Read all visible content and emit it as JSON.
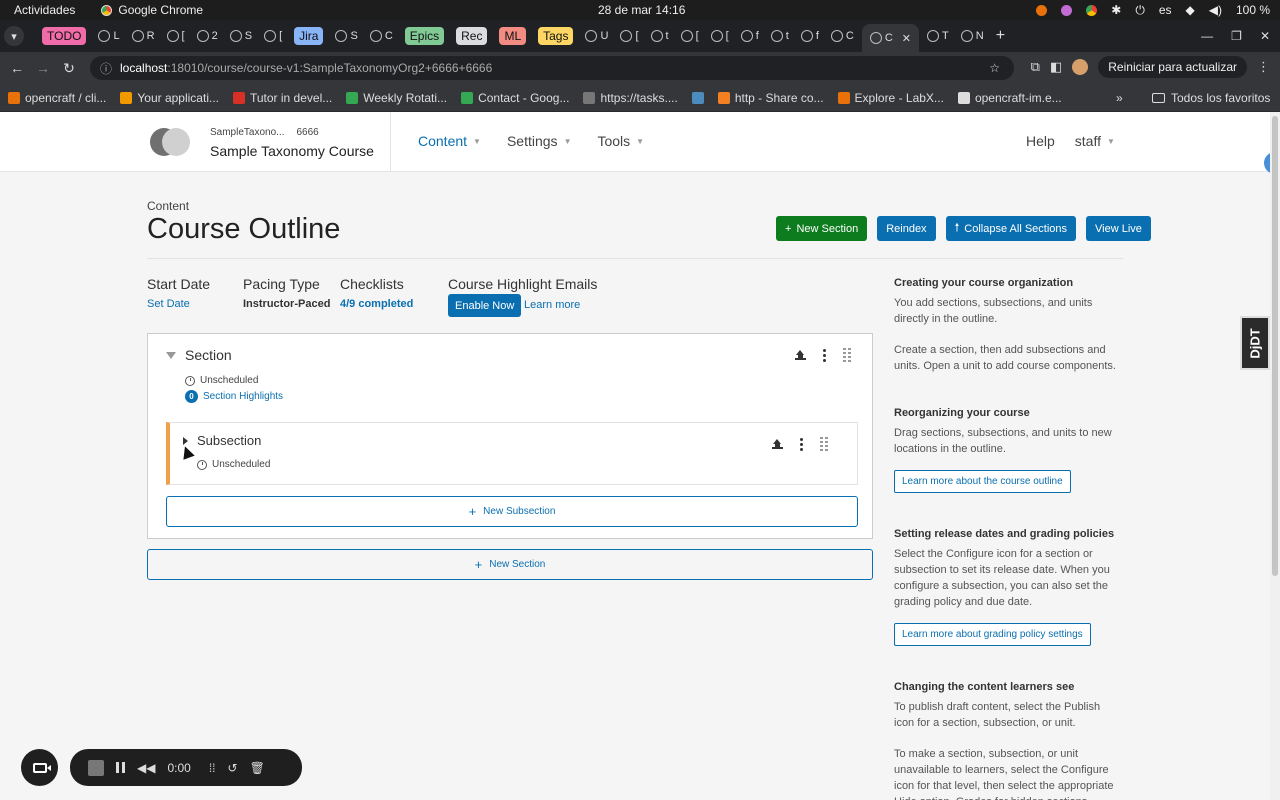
{
  "os": {
    "activities": "Actividades",
    "app_name": "Google Chrome",
    "clock": "28 de mar  14:16",
    "lang": "es",
    "battery": "100 %"
  },
  "tabs": [
    {
      "label": "TODO",
      "color": "#f06ca8",
      "pill": true
    },
    {
      "label": "L",
      "pill": false
    },
    {
      "label": "R",
      "pill": false
    },
    {
      "label": "[",
      "pill": false
    },
    {
      "label": "2",
      "pill": false
    },
    {
      "label": "S",
      "pill": false
    },
    {
      "label": "[",
      "pill": false
    },
    {
      "label": "Jira",
      "color": "#8ab4f8",
      "pill": true
    },
    {
      "label": "S",
      "pill": false
    },
    {
      "label": "C",
      "pill": false
    },
    {
      "label": "Epics",
      "color": "#81c995",
      "pill": true
    },
    {
      "label": "Rec",
      "color": "#dadce0",
      "pill": true
    },
    {
      "label": "ML",
      "color": "#f28b82",
      "pill": true
    },
    {
      "label": "Tags",
      "color": "#fdd663",
      "pill": true
    },
    {
      "label": "U",
      "pill": false
    },
    {
      "label": "[",
      "pill": false
    },
    {
      "label": "t",
      "pill": false
    },
    {
      "label": "[",
      "pill": false
    },
    {
      "label": "[",
      "pill": false
    },
    {
      "label": "f",
      "pill": false
    },
    {
      "label": "t",
      "pill": false
    },
    {
      "label": "f",
      "pill": false
    },
    {
      "label": "C",
      "pill": false
    },
    {
      "label": "C",
      "active": true
    },
    {
      "label": "T",
      "pill": false
    },
    {
      "label": "N",
      "pill": false
    }
  ],
  "address": {
    "host": "localhost",
    "path": ":18010/course/course-v1:SampleTaxonomyOrg2+6666+6666",
    "update_label": "Reiniciar para actualizar"
  },
  "bookmarks": [
    {
      "label": "opencraft / cli...",
      "color": "#e8710a"
    },
    {
      "label": "Your applicati...",
      "color": "#f29900"
    },
    {
      "label": "Tutor in devel...",
      "color": "#d93025"
    },
    {
      "label": "Weekly Rotati...",
      "color": "#34a853"
    },
    {
      "label": "Contact - Goog...",
      "color": "#34a853"
    },
    {
      "label": "https://tasks....",
      "color": "#777777"
    },
    {
      "label": "",
      "color": "#4b8bbe"
    },
    {
      "label": "http - Share co...",
      "color": "#f48024"
    },
    {
      "label": "Explore - LabX...",
      "color": "#e8710a"
    },
    {
      "label": "opencraft-im.e...",
      "color": "#dddddd"
    }
  ],
  "bookmarks_all": "Todos los favoritos",
  "studio": {
    "org": "SampleTaxono...",
    "number": "6666",
    "course_name": "Sample Taxonomy Course",
    "nav": [
      {
        "label": "Content",
        "active": true
      },
      {
        "label": "Settings"
      },
      {
        "label": "Tools"
      }
    ],
    "help": "Help",
    "user": "staff"
  },
  "page": {
    "crumb": "Content",
    "title": "Course Outline",
    "actions": {
      "new_section": "New Section",
      "reindex": "Reindex",
      "collapse_all": "Collapse All Sections",
      "view_live": "View Live"
    },
    "start_date": {
      "label": "Start Date",
      "value": "Set Date"
    },
    "pacing": {
      "label": "Pacing Type",
      "value": "Instructor-Paced"
    },
    "checklists": {
      "label": "Checklists",
      "value": "4/9 completed"
    },
    "highlights": {
      "label": "Course Highlight Emails",
      "enable": "Enable Now",
      "learn_more": "Learn more"
    }
  },
  "outline": {
    "section": {
      "title": "Section",
      "status": "Unscheduled",
      "highlights_count": "0",
      "highlights_label": "Section Highlights"
    },
    "subsection": {
      "title": "Subsection",
      "status": "Unscheduled"
    },
    "new_subsection": "New Subsection",
    "new_section": "New Section"
  },
  "help": {
    "org_title": "Creating your course organization",
    "org_p1": "You add sections, subsections, and units directly in the outline.",
    "org_p2": "Create a section, then add subsections and units. Open a unit to add course components.",
    "reorg_title": "Reorganizing your course",
    "reorg_p": "Drag sections, subsections, and units to new locations in the outline.",
    "reorg_btn": "Learn more about the course outline",
    "release_title": "Setting release dates and grading policies",
    "release_p": "Select the Configure icon for a section or subsection to set its release date. When you configure a subsection, you can also set the grading policy and due date.",
    "release_btn": "Learn more about grading policy settings",
    "changing_title": "Changing the content learners see",
    "changing_p1": "To publish draft content, select the Publish icon for a section, subsection, or unit.",
    "changing_p2": "To make a section, subsection, or unit unavailable to learners, select the Configure icon for that level, then select the appropriate Hide option. Grades for hidden sections,"
  },
  "djdt": "DjDT",
  "recorder": {
    "time": "0:00"
  }
}
